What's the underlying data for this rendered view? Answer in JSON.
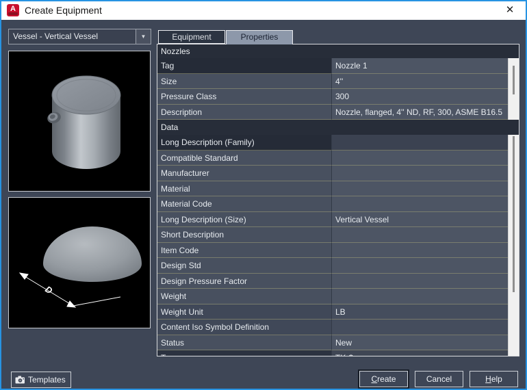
{
  "window": {
    "title": "Create Equipment"
  },
  "icons": {
    "close": "✕",
    "dropdown_arrow": "▼"
  },
  "left_panel": {
    "equipment_type": "Vessel - Vertical Vessel",
    "templates_label": "Templates",
    "dimension_label": "D"
  },
  "tabs": [
    {
      "label": "Equipment",
      "active": false
    },
    {
      "label": "Properties",
      "active": true
    }
  ],
  "grid": {
    "sections": [
      {
        "key": "nozzles",
        "title": "Nozzles",
        "rows": [
          {
            "label": "Tag",
            "value": "Nozzle 1",
            "selected": true
          },
          {
            "label": "Size",
            "value": "4''"
          },
          {
            "label": "Pressure Class",
            "value": "300"
          },
          {
            "label": "Description",
            "value": "Nozzle, flanged, 4'' ND, RF, 300, ASME B16.5"
          }
        ]
      },
      {
        "key": "data",
        "title": "Data",
        "rows": [
          {
            "label": "Long Description (Family)",
            "value": "",
            "selected": true
          },
          {
            "label": "Compatible Standard",
            "value": ""
          },
          {
            "label": "Manufacturer",
            "value": ""
          },
          {
            "label": "Material",
            "value": ""
          },
          {
            "label": "Material Code",
            "value": ""
          },
          {
            "label": "Long Description (Size)",
            "value": "Vertical Vessel"
          },
          {
            "label": "Short Description",
            "value": ""
          },
          {
            "label": "Item Code",
            "value": ""
          },
          {
            "label": "Design Std",
            "value": ""
          },
          {
            "label": "Design Pressure Factor",
            "value": ""
          },
          {
            "label": "Weight",
            "value": ""
          },
          {
            "label": "Weight Unit",
            "value": "LB",
            "shade": true
          },
          {
            "label": "Content Iso Symbol Definition",
            "value": "",
            "shade": true
          },
          {
            "label": "Status",
            "value": "New"
          },
          {
            "label": "Tag",
            "value": "TK-?",
            "clipped": true
          }
        ]
      }
    ]
  },
  "footer": {
    "buttons": [
      {
        "id": "create",
        "label": "Create",
        "accel": true,
        "default": true
      },
      {
        "id": "cancel",
        "label": "Cancel",
        "accel": false
      },
      {
        "id": "help",
        "label": "Help",
        "accel": true
      }
    ]
  },
  "colors": {
    "window_border": "#2793e2",
    "titlebar_bg": "#ffffff",
    "dialog_bg": "#3e4656",
    "section_header_bg": "#272d39",
    "row_label_bg": "#48505f",
    "row_value_bg": "#4d5564",
    "selected_row_bg": "#252b37",
    "active_tab_bg": "#8d98aa",
    "scrollbar_track": "#f0f0f0",
    "preview_bg": "#000000",
    "app_icon_red": "#c8102e"
  }
}
